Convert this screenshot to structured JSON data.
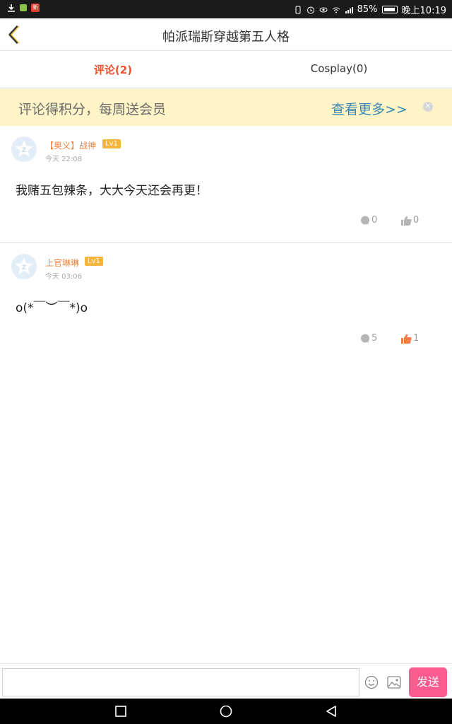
{
  "status_bar": {
    "left_badge": "新",
    "battery_percent": "85%",
    "time": "晚上10:19"
  },
  "header": {
    "title": "帕派瑞斯穿越第五人格"
  },
  "tabs": [
    {
      "label": "评论(2)",
      "active": true
    },
    {
      "label": "Cosplay(0)",
      "active": false
    }
  ],
  "banner": {
    "text": "评论得积分，每周送会员",
    "more": "查看更多>>"
  },
  "comments": [
    {
      "username": "【奥义】战神",
      "level": "Lv1",
      "time": "今天 22:08",
      "text": "我赌五包辣条，大大今天还会再更！",
      "reply_count": "0",
      "like_count": "0",
      "liked": false
    },
    {
      "username": "上官琳琳",
      "level": "Lv1",
      "time": "今天 03:06",
      "text": "o(*￣︶￣*)o",
      "reply_count": "5",
      "like_count": "1",
      "liked": true
    }
  ],
  "input_bar": {
    "placeholder": "",
    "send_label": "发送"
  },
  "colors": {
    "accent": "#f0502d",
    "send_button": "#fb5c8f",
    "banner_bg": "#fef4c7",
    "level_badge": "#f5b53a",
    "like_active": "#f47c45"
  }
}
